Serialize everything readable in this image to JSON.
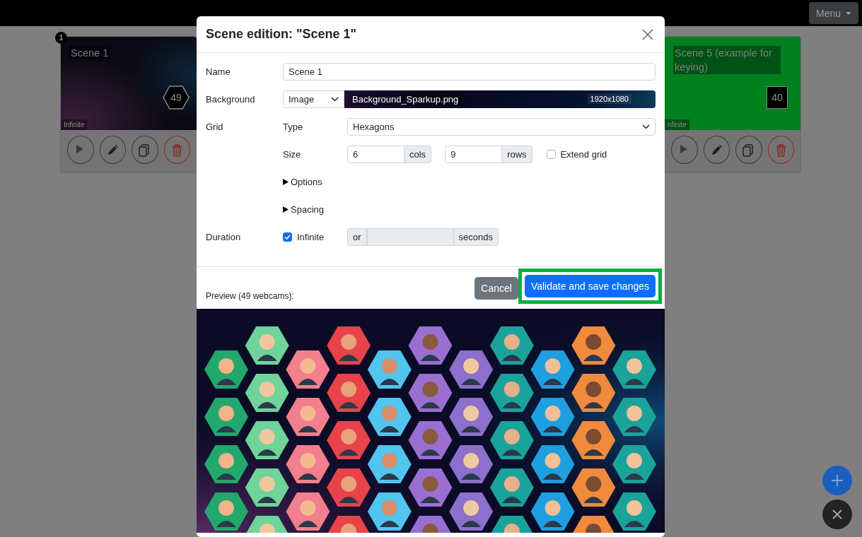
{
  "top_bar": {
    "menu_button": "Menu"
  },
  "scenes": [
    {
      "number": "1",
      "title": "Scene 1",
      "count": {
        "text": "49",
        "kind": "hexagon"
      },
      "duration": "Infinite"
    },
    {
      "title": "Scene 5 (example for keying)",
      "count": {
        "text": "40",
        "kind": "square"
      },
      "duration": "nfinite",
      "background": {
        "kind": "color",
        "color": "#00801f"
      }
    }
  ],
  "dialog": {
    "title": "Scene edition: \"Scene 1\"",
    "name": {
      "label": "Name",
      "value": "Scene 1"
    },
    "background": {
      "label": "Background",
      "type": "Image",
      "file": "Background_Sparkup.png",
      "resolution": "1920x1080"
    },
    "grid": {
      "label": "Grid",
      "type_label": "Type",
      "type": "Hexagons",
      "size_label": "Size",
      "cols": "6",
      "cols_unit": "cols",
      "rows": "9",
      "rows_unit": "rows",
      "extend": {
        "label": "Extend grid",
        "checked": false
      },
      "sections": [
        {
          "label": "Options",
          "expanded": false
        },
        {
          "label": "Spacing",
          "expanded": false
        }
      ]
    },
    "duration": {
      "label": "Duration",
      "infinite": {
        "label": "Infinite",
        "checked": true
      },
      "prefix": "or",
      "unit": "seconds"
    },
    "buttons": [
      {
        "label": "Cancel",
        "kind": "secondary",
        "highlighted": false
      },
      {
        "label": "Validate and save changes",
        "kind": "primary",
        "highlighted": true
      }
    ],
    "preview": {
      "label": "Preview (49 webcams):",
      "kind": "picture"
    }
  },
  "floating_buttons": [
    {
      "kind": "add"
    },
    {
      "kind": "close"
    }
  ]
}
